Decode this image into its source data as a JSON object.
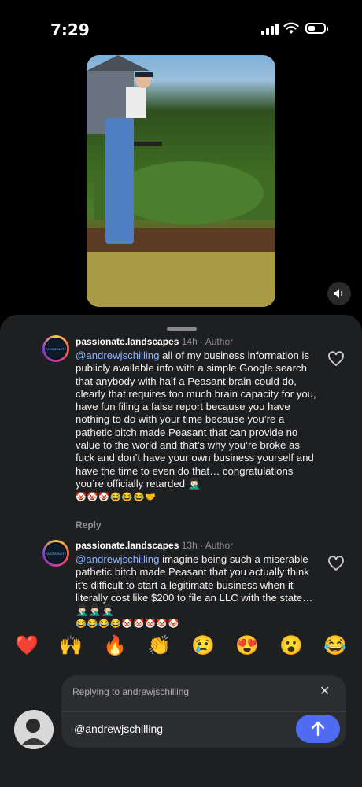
{
  "status_bar": {
    "time": "7:29"
  },
  "video": {
    "description_icon": "speaker-icon"
  },
  "comments": [
    {
      "username": "passionate.landscapes",
      "meta": "14h · Author",
      "mention": "@andrewjschilling",
      "text": " all of my business information is publicly available info with a simple Google search that anybody with half a Peasant brain could do, clearly that requires too much brain capacity for you, have fun filing a false report because you have nothing to do with your time because you’re a pathetic bitch made Peasant that can provide no value to the world and that’s why you’re broke as fuck and don’t have your own business yourself and have the time to even do that… congratulations you’re officially retarded 🤦🏻‍♂️",
      "emoji": "🤡🤡🤡😂😂😂🤝",
      "reply_label": "Reply"
    },
    {
      "username": "passionate.landscapes",
      "meta": "13h · Author",
      "mention": "@andrewjschilling",
      "text": " imagine being such a miserable pathetic bitch made Peasant that you actually think it’s difficult to start a legitimate business when it literally cost like $200 to file an LLC with the state… 🤦🏻‍♂️🤦🏻‍♂️🤦🏻‍♂️",
      "emoji": "😂😂😂😂🤡🤡🤡🤡🤡"
    }
  ],
  "reactions": [
    "❤️",
    "🙌",
    "🔥",
    "👏",
    "😢",
    "😍",
    "😮",
    "😂"
  ],
  "reply_box": {
    "replying_to": "Replying to andrewjschilling",
    "input_value": "@andrewjschilling",
    "close_icon": "close-icon",
    "send_icon": "arrow-up-icon"
  },
  "colors": {
    "accent": "#4e6bf2",
    "mention": "#8ab4ff",
    "sheet": "#1e1f21"
  }
}
